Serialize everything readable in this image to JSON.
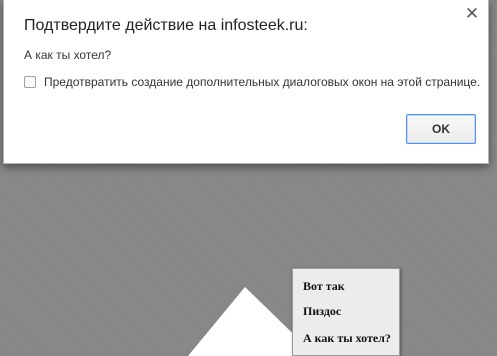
{
  "dialog": {
    "title": "Подтвердите действие на infosteek.ru:",
    "message": "А как ты хотел?",
    "checkbox_label": "Предотвратить создание дополнительных диалоговых окон на этой странице.",
    "checkbox_checked": false,
    "ok_label": "OK",
    "close_icon": "close-icon"
  },
  "menu": {
    "items": [
      {
        "label": "Вот так"
      },
      {
        "label": "Пиздос"
      },
      {
        "label": "А как ты хотел?"
      }
    ]
  }
}
